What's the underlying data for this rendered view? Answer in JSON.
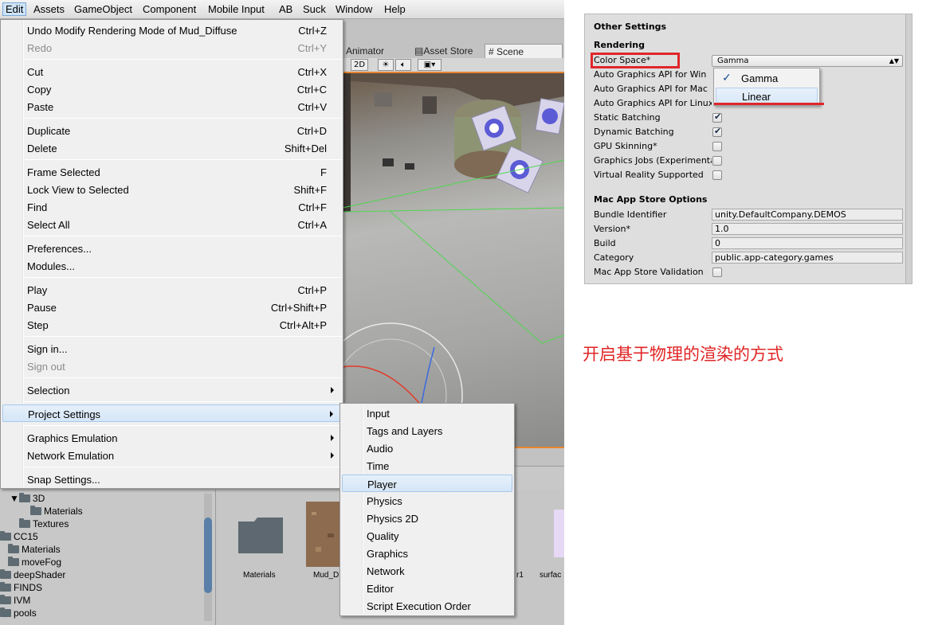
{
  "menubar": {
    "items": [
      "Edit",
      "Assets",
      "GameObject",
      "Component",
      "Mobile Input",
      "AB",
      "Suck",
      "Window",
      "Help"
    ]
  },
  "scene_tabs": {
    "animator": "Animator",
    "asset_store": "Asset Store",
    "scene": "Scene"
  },
  "scene_toolbar": {
    "mode_2d": "2D"
  },
  "edit_menu": {
    "items": [
      {
        "label": "Undo Modify Rendering Mode of Mud_Diffuse",
        "shortcut": "Ctrl+Z"
      },
      {
        "label": "Redo",
        "shortcut": "Ctrl+Y"
      },
      {
        "label": "Cut",
        "shortcut": "Ctrl+X"
      },
      {
        "label": "Copy",
        "shortcut": "Ctrl+C"
      },
      {
        "label": "Paste",
        "shortcut": "Ctrl+V"
      },
      {
        "label": "Duplicate",
        "shortcut": "Ctrl+D"
      },
      {
        "label": "Delete",
        "shortcut": "Shift+Del"
      },
      {
        "label": "Frame Selected",
        "shortcut": "F"
      },
      {
        "label": "Lock View to Selected",
        "shortcut": "Shift+F"
      },
      {
        "label": "Find",
        "shortcut": "Ctrl+F"
      },
      {
        "label": "Select All",
        "shortcut": "Ctrl+A"
      },
      {
        "label": "Preferences...",
        "shortcut": ""
      },
      {
        "label": "Modules...",
        "shortcut": ""
      },
      {
        "label": "Play",
        "shortcut": "Ctrl+P"
      },
      {
        "label": "Pause",
        "shortcut": "Ctrl+Shift+P"
      },
      {
        "label": "Step",
        "shortcut": "Ctrl+Alt+P"
      },
      {
        "label": "Sign in...",
        "shortcut": ""
      },
      {
        "label": "Sign out",
        "shortcut": ""
      },
      {
        "label": "Selection",
        "shortcut": ""
      },
      {
        "label": "Project Settings",
        "shortcut": ""
      },
      {
        "label": "Graphics Emulation",
        "shortcut": ""
      },
      {
        "label": "Network Emulation",
        "shortcut": ""
      },
      {
        "label": "Snap Settings...",
        "shortcut": ""
      }
    ]
  },
  "project_settings_menu": {
    "items": [
      "Input",
      "Tags and Layers",
      "Audio",
      "Time",
      "Player",
      "Physics",
      "Physics 2D",
      "Quality",
      "Graphics",
      "Network",
      "Editor",
      "Script Execution Order"
    ],
    "selected": "Player"
  },
  "project_tree": {
    "items": [
      "3D",
      "Materials",
      "Textures",
      "CC15",
      "Materials",
      "moveFog",
      "deepShader",
      "FINDS",
      "IVM",
      "pools"
    ]
  },
  "assets": {
    "items": [
      "Materials",
      "Mud_D",
      "r1",
      "surfac"
    ]
  },
  "inspector": {
    "section_title": "Other Settings",
    "rendering_header": "Rendering",
    "color_space": {
      "label": "Color Space*",
      "value": "Gamma",
      "options": [
        "Gamma",
        "Linear"
      ],
      "highlighted": "Linear"
    },
    "rows": [
      {
        "label": "Auto Graphics API for Win"
      },
      {
        "label": "Auto Graphics API for Mac"
      },
      {
        "label": "Auto Graphics API for Linux"
      },
      {
        "label": "Static Batching",
        "checked": true
      },
      {
        "label": "Dynamic Batching",
        "checked": true
      },
      {
        "label": "GPU Skinning*",
        "checked": false
      },
      {
        "label": "Graphics Jobs (Experimental)",
        "checked": false
      },
      {
        "label": "Virtual Reality Supported",
        "checked": false
      }
    ],
    "mac_header": "Mac App Store Options",
    "mac_rows": [
      {
        "label": "Bundle Identifier",
        "value": "unity.DefaultCompany.DEMOS"
      },
      {
        "label": "Version*",
        "value": "1.0"
      },
      {
        "label": "Build",
        "value": "0"
      },
      {
        "label": "Category",
        "value": "public.app-category.games"
      }
    ],
    "validation": {
      "label": "Mac App Store Validation",
      "checked": false
    }
  },
  "annotation": "开启基于物理的渲染的方式",
  "colors": {
    "menu_highlight": "#d5e6f7",
    "annotation_red": "#e02525",
    "scene_orange": "#e7842f"
  }
}
